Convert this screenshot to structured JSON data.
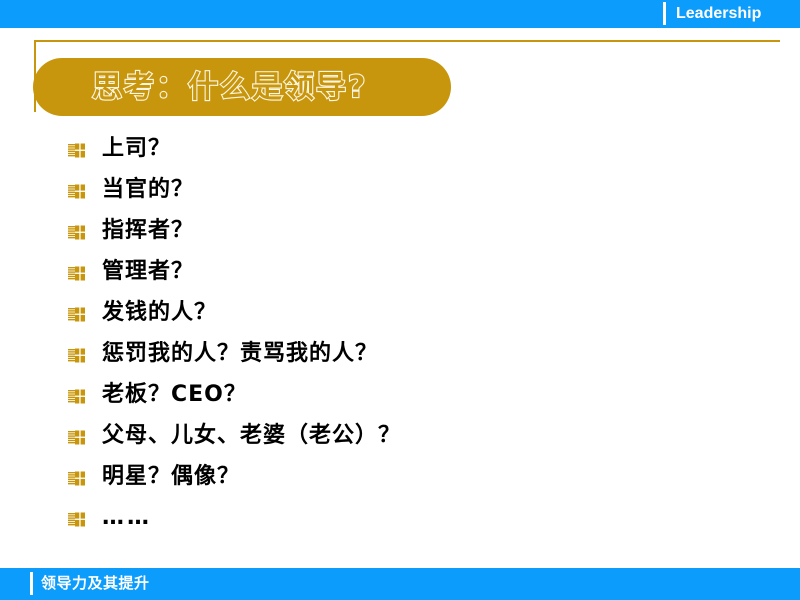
{
  "colors": {
    "header_blue": "#0b9cfc",
    "gold": "#c8960c",
    "title_outline": "#fdf6e4",
    "body_text": "#000000",
    "background": "#ffffff"
  },
  "header": {
    "title": "Leadership",
    "separator_icon": "vertical-rule-icon"
  },
  "slide": {
    "title": "思考：什么是领导?",
    "bullet_icon_name": "gold-flag-bullet-icon",
    "bullets": [
      {
        "label": "上司？"
      },
      {
        "label": "当官的？"
      },
      {
        "label": "指挥者？"
      },
      {
        "label": "管理者？"
      },
      {
        "label": "发钱的人？"
      },
      {
        "label": "惩罚我的人？责骂我的人？"
      },
      {
        "label": "老板？CEO？"
      },
      {
        "label": "父母、儿女、老婆（老公）？"
      },
      {
        "label": "明星？偶像？"
      },
      {
        "label": "……"
      }
    ]
  },
  "footer": {
    "title": "领导力及其提升",
    "separator_icon": "vertical-rule-icon"
  }
}
